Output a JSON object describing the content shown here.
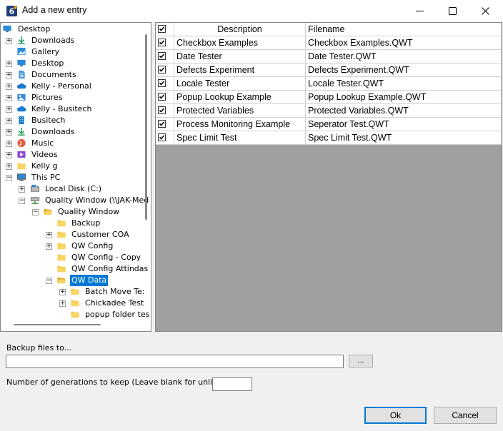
{
  "window": {
    "title": "Add a new entry",
    "app_icon": "app-6-icon"
  },
  "tree": {
    "items": [
      {
        "label": "Desktop",
        "icon": "desktop-icon"
      },
      {
        "label": "Downloads",
        "icon": "download-icon"
      },
      {
        "label": "Gallery",
        "icon": "gallery-icon"
      },
      {
        "label": "Desktop",
        "icon": "desktop-icon"
      },
      {
        "label": "Documents",
        "icon": "documents-icon"
      },
      {
        "label": "Kelly - Personal",
        "icon": "cloud-icon"
      },
      {
        "label": "Pictures",
        "icon": "pictures-icon"
      },
      {
        "label": "Kelly - Busitech",
        "icon": "cloud-icon"
      },
      {
        "label": "Busitech",
        "icon": "building-icon"
      },
      {
        "label": "Downloads",
        "icon": "download-icon"
      },
      {
        "label": "Music",
        "icon": "music-icon"
      },
      {
        "label": "Videos",
        "icon": "videos-icon"
      },
      {
        "label": "Kelly g",
        "icon": "folder-icon"
      },
      {
        "label": "This PC",
        "icon": "computer-icon"
      },
      {
        "label": "Local Disk (C:)",
        "icon": "drive-icon"
      },
      {
        "label": "Quality Window (\\\\JAK-Med",
        "icon": "network-drive-icon"
      },
      {
        "label": "Quality Window",
        "icon": "folder-open-icon"
      },
      {
        "label": "Backup",
        "icon": "folder-icon"
      },
      {
        "label": "Customer COA",
        "icon": "folder-icon"
      },
      {
        "label": "QW Config",
        "icon": "folder-icon"
      },
      {
        "label": "QW Config - Copy",
        "icon": "folder-icon"
      },
      {
        "label": "QW Config Attindas",
        "icon": "folder-icon"
      },
      {
        "label": "QW Data",
        "icon": "folder-open-icon"
      },
      {
        "label": "Batch Move Te:",
        "icon": "folder-icon"
      },
      {
        "label": "Chickadee Test",
        "icon": "folder-icon"
      },
      {
        "label": "popup folder tes",
        "icon": "folder-icon"
      }
    ]
  },
  "grid": {
    "headers": {
      "description": "Description",
      "filename": "Filename"
    },
    "rows": [
      {
        "checked": true,
        "description": "Checkbox Examples",
        "filename": "Checkbox Examples.QWT"
      },
      {
        "checked": true,
        "description": "Date Tester",
        "filename": "Date Tester.QWT"
      },
      {
        "checked": true,
        "description": "Defects Experiment",
        "filename": "Defects Experiment.QWT"
      },
      {
        "checked": true,
        "description": "Locale Tester",
        "filename": "Locale Tester.QWT"
      },
      {
        "checked": true,
        "description": "Popup Lookup Example",
        "filename": "Popup Lookup Example.QWT"
      },
      {
        "checked": true,
        "description": "Protected Variables",
        "filename": "Protected Variables.QWT"
      },
      {
        "checked": true,
        "description": "Process Monitoring Example",
        "filename": "Seperator Test.QWT"
      },
      {
        "checked": true,
        "description": "Spec Limit Test",
        "filename": "Spec Limit Test.QWT"
      }
    ]
  },
  "backup": {
    "label": "Backup files to...",
    "value": "",
    "browse_label": "..."
  },
  "generations": {
    "label": "Number of generations to keep (Leave blank for unlimited)",
    "value": ""
  },
  "buttons": {
    "ok": "Ok",
    "cancel": "Cancel"
  },
  "colors": {
    "selection": "#0078d7",
    "grid_empty": "#a0a0a0"
  }
}
